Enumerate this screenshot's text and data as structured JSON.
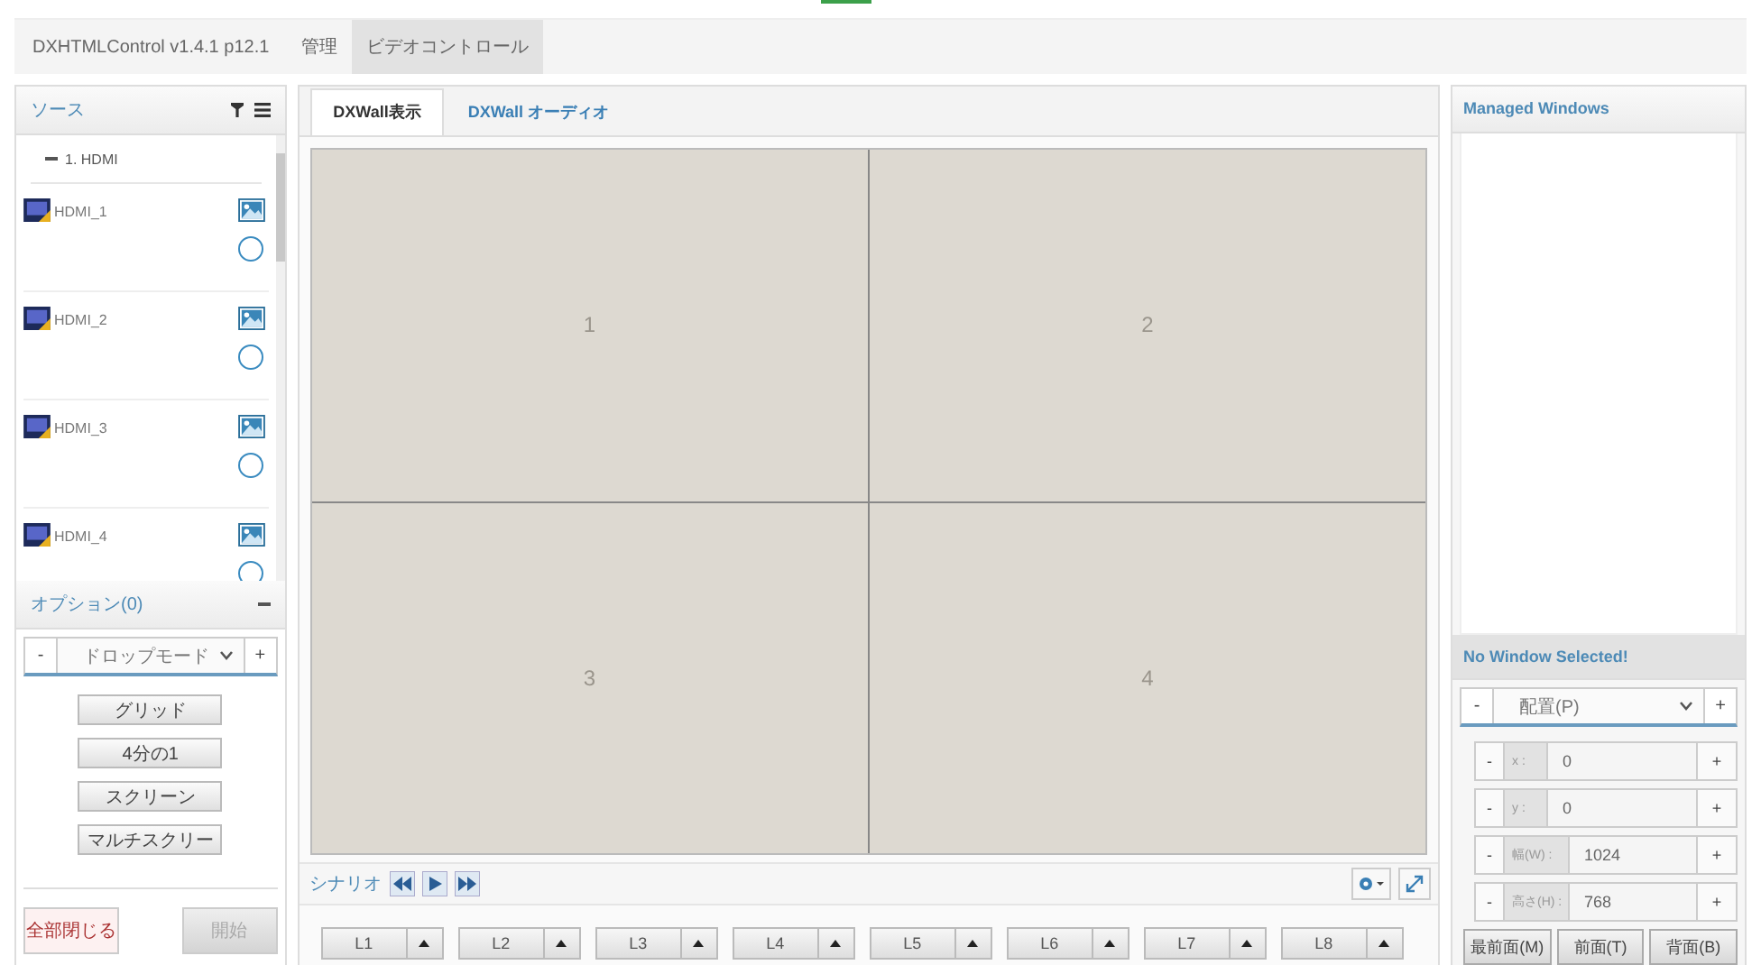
{
  "nav": {
    "brand": "DXHTMLControl v1.4.1 p12.1",
    "items": [
      {
        "label": "管理",
        "selected": false
      },
      {
        "label": "ビデオコントロール",
        "selected": true
      }
    ]
  },
  "sources": {
    "title": "ソース",
    "group": {
      "label": "1. HDMI",
      "expanded": true
    },
    "items": [
      {
        "label": "HDMI_1"
      },
      {
        "label": "HDMI_2"
      },
      {
        "label": "HDMI_3"
      },
      {
        "label": "HDMI_4"
      }
    ]
  },
  "options": {
    "title": "オプション(0)",
    "minus": "-",
    "mode": "ドロップモード",
    "plus": "+",
    "buttons": [
      "グリッド",
      "4分の1",
      "スクリーン",
      "マルチスクリー"
    ]
  },
  "footer_buttons": [
    {
      "label": "全部閉じる",
      "disabled": false
    },
    {
      "label": "開始",
      "disabled": true
    }
  ],
  "tabs": [
    {
      "label": "DXWall表示",
      "selected": true
    },
    {
      "label": "DXWall オーディオ",
      "selected": false
    }
  ],
  "wall": {
    "cells": [
      "1",
      "2",
      "3",
      "4"
    ]
  },
  "scenario": {
    "label": "シナリオ"
  },
  "layouts": [
    "L1",
    "L2",
    "L3",
    "L4",
    "L5",
    "L6",
    "L7",
    "L8"
  ],
  "managed_windows": {
    "title": "Managed Windows"
  },
  "selection": {
    "title": "No Window Selected!",
    "minus": "-",
    "arrange": "配置(P)",
    "plus": "+"
  },
  "fields": [
    {
      "minus": "-",
      "label": "x :",
      "value": "0",
      "plus": "+"
    },
    {
      "minus": "-",
      "label": "y :",
      "value": "0",
      "plus": "+"
    },
    {
      "minus": "-",
      "label": "幅(W) :",
      "value": "1024",
      "plus": "+"
    },
    {
      "minus": "-",
      "label": "高さ(H) :",
      "value": "768",
      "plus": "+"
    }
  ],
  "order_buttons": [
    "最前面(M)",
    "前面(T)",
    "背面(B)"
  ]
}
